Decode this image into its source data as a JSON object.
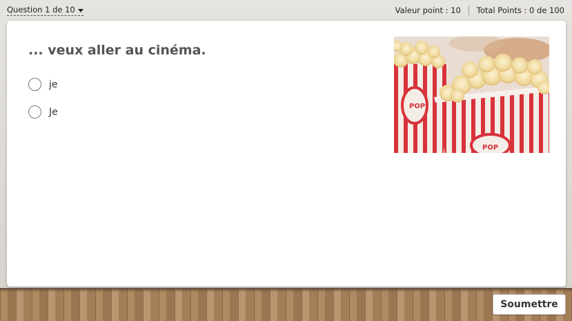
{
  "header": {
    "question_menu_label": "Question 1 de 10",
    "point_value": "Valeur point : 10",
    "total_points": "Total Points : 0 de 100"
  },
  "question": {
    "prompt": "... veux aller au cinéma.",
    "options": [
      {
        "label": "je"
      },
      {
        "label": "Je"
      }
    ],
    "image": {
      "icon": "popcorn-photo"
    }
  },
  "footer": {
    "submit_label": "Soumettre"
  },
  "colors": {
    "prompt_text": "#555555",
    "popcorn_stripe": "#d8323a"
  }
}
